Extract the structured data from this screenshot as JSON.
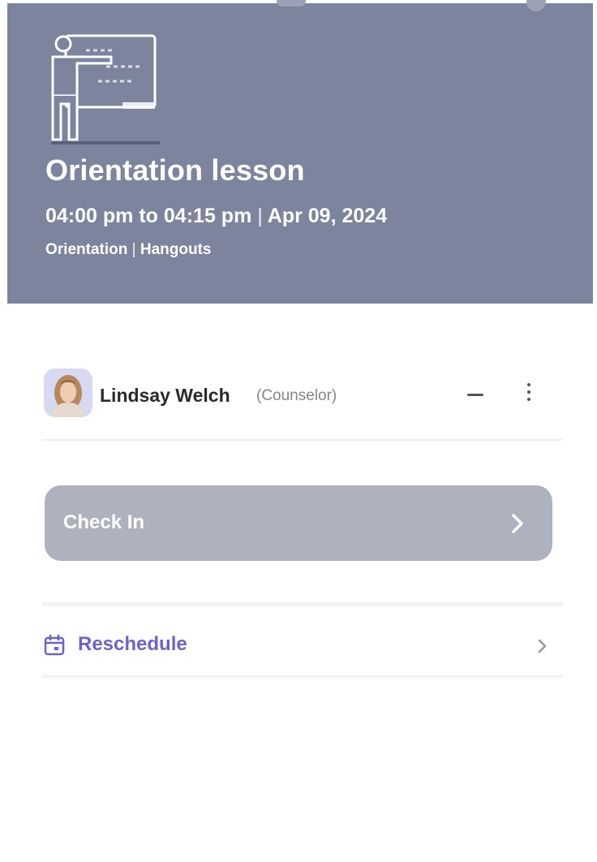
{
  "event": {
    "title": "Orientation lesson",
    "start_time": "04:00 pm",
    "to_word": "to",
    "end_time": "04:15 pm",
    "separator": "|",
    "date": "Apr 09, 2024",
    "category": "Orientation",
    "platform": "Hangouts"
  },
  "attendee": {
    "name": "Lindsay Welch",
    "role": "(Counselor)"
  },
  "actions": {
    "check_in_label": "Check In",
    "reschedule_label": "Reschedule"
  },
  "icons": {
    "header_illustration": "teacher-whiteboard-icon",
    "collapse": "minus-icon",
    "more": "kebab-menu-icon",
    "check_in_chevron": "chevron-right-icon",
    "reschedule": "calendar-icon",
    "reschedule_chevron": "chevron-right-icon"
  },
  "colors": {
    "header_bg": "#7d849d",
    "check_in_bg": "#aeb2bf",
    "accent": "#6e62c8",
    "avatar_bg": "#d7d9f1"
  }
}
